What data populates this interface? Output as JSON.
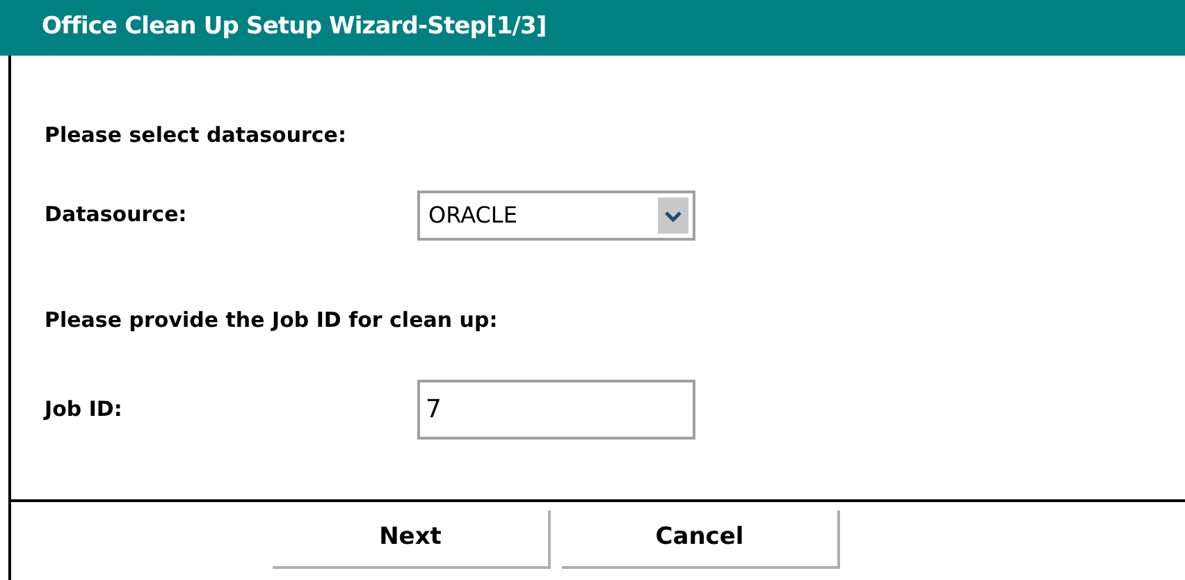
{
  "window": {
    "title": "Office Clean Up Setup Wizard-Step[1/3]"
  },
  "datasource_section": {
    "prompt": "Please select datasource:",
    "label": "Datasource:",
    "value": "ORACLE"
  },
  "job_section": {
    "prompt": "Please provide the Job ID for clean up:",
    "label": "Job ID:",
    "value": "7"
  },
  "buttons": [
    "Next",
    "Cancel"
  ]
}
